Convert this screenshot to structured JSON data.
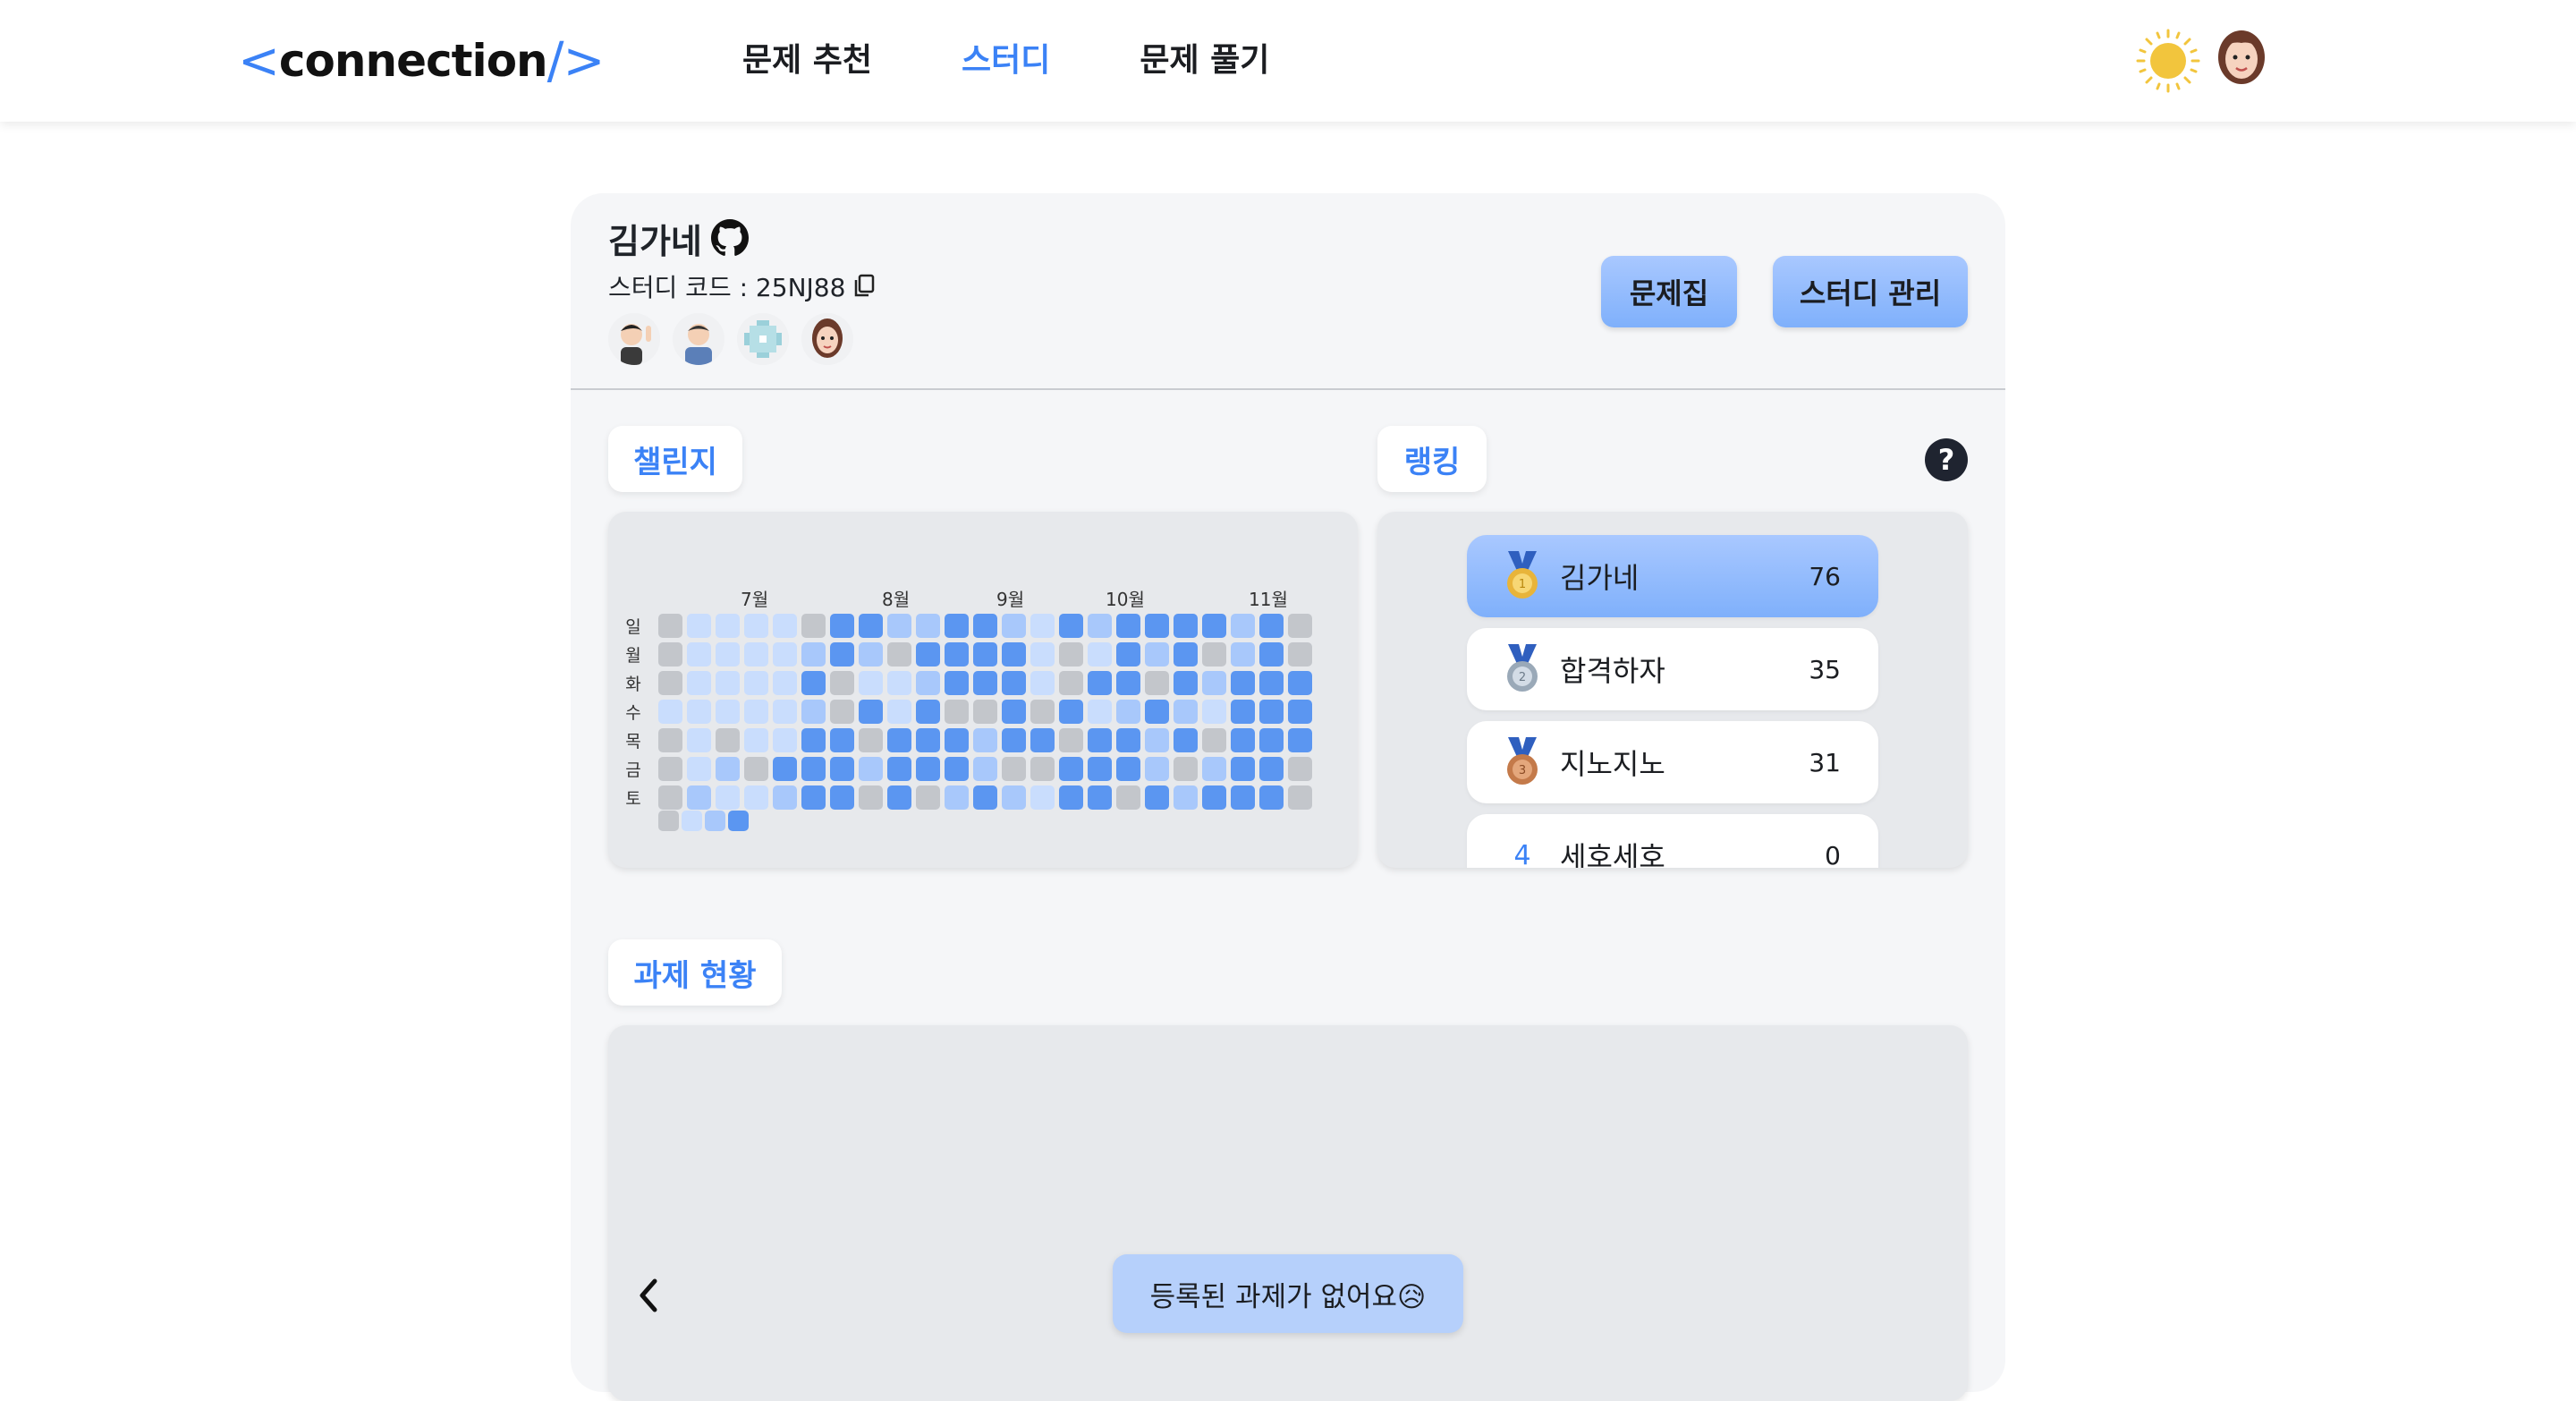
{
  "header": {
    "logo_open": "<",
    "logo_text": "connection",
    "logo_close": "/>",
    "nav": [
      {
        "label": "문제 추천",
        "active": false
      },
      {
        "label": "스터디",
        "active": true
      },
      {
        "label": "문제 풀기",
        "active": false
      }
    ],
    "theme_icon": "sun-icon",
    "accent": "#3b82f6"
  },
  "study": {
    "name": "김가네",
    "repo_icon": "github-icon",
    "code_label": "스터디 코드 : 25NJ88",
    "copy_icon": "copy-icon",
    "members": [
      "member-1",
      "member-2",
      "member-3",
      "member-4"
    ],
    "buttons": {
      "problem_set": "문제집",
      "manage": "스터디 관리"
    }
  },
  "challenge": {
    "title": "챌린지",
    "months": [
      "7월",
      "8월",
      "9월",
      "10월",
      "11월"
    ],
    "days": [
      "일",
      "월",
      "화",
      "수",
      "목",
      "금",
      "토"
    ],
    "levels": [
      "#c3c6cb",
      "#c9ddfd",
      "#a8c8fb",
      "#5b96f1"
    ],
    "grid": [
      [
        0,
        1,
        1,
        1,
        1,
        0,
        3,
        3,
        2,
        2,
        3,
        3,
        2,
        1,
        3,
        2,
        3,
        3,
        3,
        3,
        2,
        3,
        0
      ],
      [
        0,
        1,
        1,
        1,
        1,
        2,
        3,
        2,
        0,
        3,
        3,
        3,
        3,
        1,
        0,
        1,
        3,
        2,
        3,
        0,
        2,
        3,
        0
      ],
      [
        0,
        1,
        1,
        1,
        1,
        3,
        0,
        1,
        1,
        2,
        3,
        3,
        3,
        1,
        0,
        3,
        3,
        0,
        3,
        2,
        3,
        3,
        3
      ],
      [
        1,
        1,
        1,
        1,
        1,
        2,
        0,
        3,
        1,
        3,
        0,
        0,
        3,
        0,
        3,
        1,
        2,
        3,
        2,
        1,
        3,
        3,
        3
      ],
      [
        0,
        1,
        0,
        1,
        1,
        3,
        3,
        0,
        3,
        3,
        3,
        2,
        3,
        3,
        0,
        3,
        3,
        2,
        3,
        0,
        3,
        3,
        3
      ],
      [
        0,
        1,
        2,
        0,
        3,
        3,
        3,
        2,
        3,
        3,
        3,
        2,
        0,
        0,
        3,
        3,
        3,
        2,
        0,
        2,
        3,
        3,
        0
      ],
      [
        0,
        2,
        1,
        1,
        2,
        3,
        3,
        0,
        3,
        0,
        2,
        3,
        2,
        1,
        3,
        3,
        0,
        3,
        2,
        3,
        3,
        3,
        0
      ]
    ],
    "legend": [
      0,
      1,
      2,
      3
    ]
  },
  "ranking": {
    "title": "랭킹",
    "help_label": "?",
    "items": [
      {
        "rank": "1",
        "name": "김가네",
        "score": "76",
        "medal": "gold-medal-icon"
      },
      {
        "rank": "2",
        "name": "합격하자",
        "score": "35",
        "medal": "silver-medal-icon"
      },
      {
        "rank": "3",
        "name": "지노지노",
        "score": "31",
        "medal": "bronze-medal-icon"
      },
      {
        "rank": "4",
        "name": "세호세호",
        "score": "0",
        "medal": ""
      }
    ]
  },
  "tasks": {
    "title": "과제 현황",
    "empty_message": "등록된 과제가 없어요😥"
  }
}
